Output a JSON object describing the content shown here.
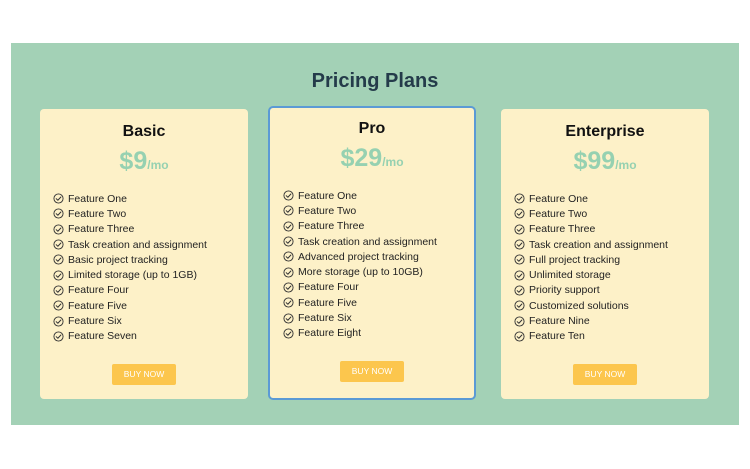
{
  "section": {
    "title": "Pricing Plans"
  },
  "plans": [
    {
      "name": "Basic",
      "price": "$9",
      "period": "/mo",
      "features": [
        "Feature One",
        "Feature Two",
        "Feature Three",
        "Task creation and assignment",
        "Basic project tracking",
        "Limited storage (up to 1GB)",
        "Feature Four",
        "Feature Five",
        "Feature Six",
        "Feature Seven"
      ],
      "button": "BUY NOW"
    },
    {
      "name": "Pro",
      "price": "$29",
      "period": "/mo",
      "features": [
        "Feature One",
        "Feature Two",
        "Feature Three",
        "Task creation and assignment",
        "Advanced project tracking",
        "More storage (up to 10GB)",
        "Feature Four",
        "Feature Five",
        "Feature Six",
        "Feature Eight"
      ],
      "button": "BUY NOW"
    },
    {
      "name": "Enterprise",
      "price": "$99",
      "period": "/mo",
      "features": [
        "Feature One",
        "Feature Two",
        "Feature Three",
        "Task creation and assignment",
        "Full project tracking",
        "Unlimited storage",
        "Priority support",
        "Customized solutions",
        "Feature Nine",
        "Feature Ten"
      ],
      "button": "BUY NOW"
    }
  ],
  "colors": {
    "background": "#a3d1b6",
    "card": "#fdf1c8",
    "price": "#96d1b1",
    "button": "#fcc64d",
    "highlight_border": "#5b9ad5"
  },
  "icons": {
    "feature": "check-circle-icon"
  }
}
